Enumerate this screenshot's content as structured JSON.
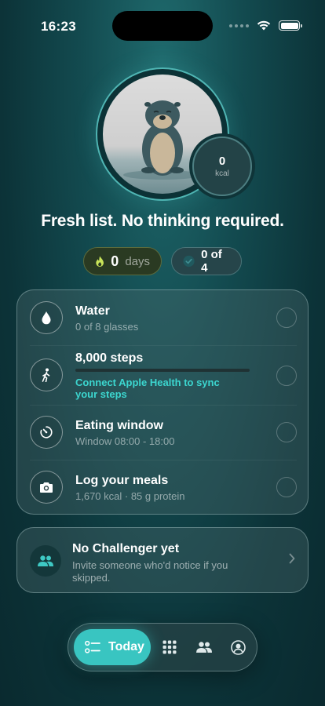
{
  "status_bar": {
    "time": "16:23",
    "icons": [
      "cellular-icon",
      "wifi-icon",
      "battery-icon"
    ]
  },
  "hero": {
    "avatar": "otter-mascot-image",
    "kcal": {
      "value": "0",
      "unit": "kcal"
    },
    "headline": "Fresh list. No thinking required."
  },
  "stats": {
    "streak": {
      "icon": "flame-icon",
      "value": "0",
      "label": "days"
    },
    "progress": {
      "icon": "check-circle-icon",
      "value": "0 of 4"
    }
  },
  "tasks": [
    {
      "icon": "water-drop-icon",
      "title": "Water",
      "subtitle": "0 of 8 glasses"
    },
    {
      "icon": "walking-person-icon",
      "title": "8,000 steps",
      "link": "Connect Apple Health to sync your steps",
      "progress": 0
    },
    {
      "icon": "timer-icon",
      "title": "Eating window",
      "subtitle": "Window 08:00 - 18:00"
    },
    {
      "icon": "camera-icon",
      "title": "Log your meals",
      "subtitle": "1,670 kcal · 85 g protein"
    }
  ],
  "challenger": {
    "icon": "people-icon",
    "title": "No Challenger yet",
    "subtitle": "Invite someone who'd notice if you skipped."
  },
  "tab_bar": {
    "active": {
      "icon": "checklist-icon",
      "label": "Today"
    },
    "items": [
      "grid-icon",
      "people-icon",
      "profile-icon"
    ]
  },
  "colors": {
    "accent": "#39c5c1",
    "link": "#3cd6cf",
    "background": "#134b50",
    "streak_flame": "#c9e45a"
  }
}
